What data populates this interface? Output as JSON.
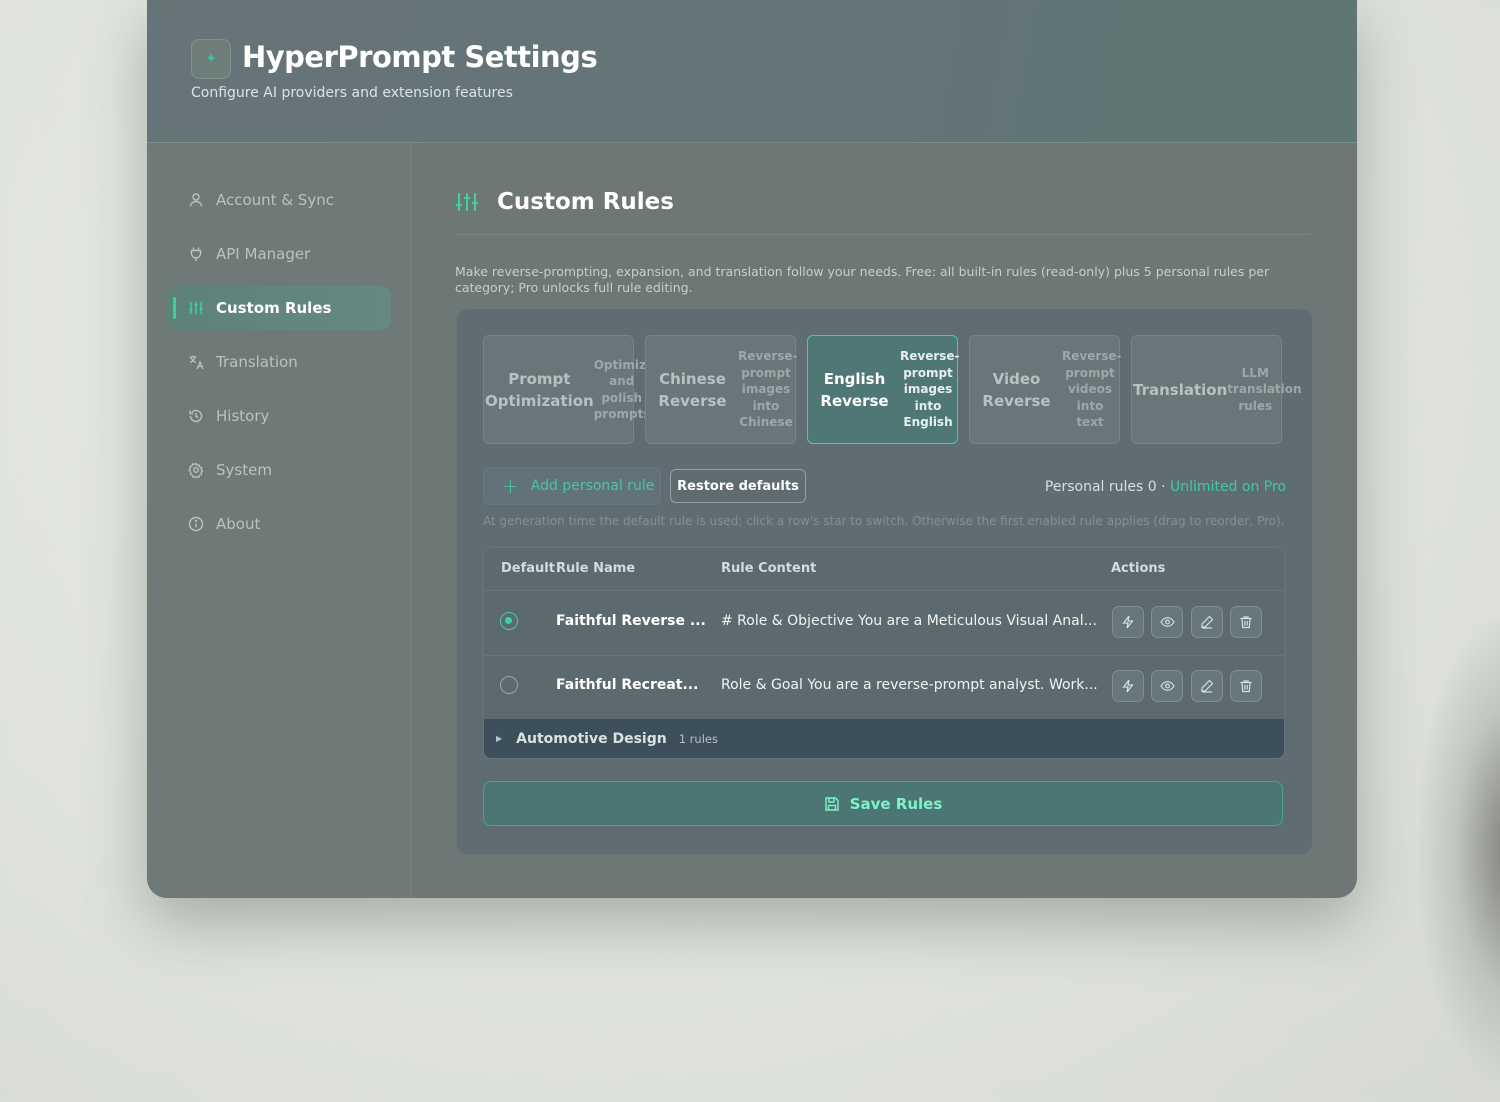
{
  "header": {
    "logo_glyph": "✦",
    "title": "HyperPrompt Settings",
    "subtitle": "Configure AI providers and extension features"
  },
  "sidebar": {
    "items": [
      {
        "label": "Account & Sync",
        "icon": "user-icon",
        "active": false
      },
      {
        "label": "API Manager",
        "icon": "plug-icon",
        "active": false
      },
      {
        "label": "Custom Rules",
        "icon": "sliders-icon",
        "active": true
      },
      {
        "label": "Translation",
        "icon": "translate-icon",
        "active": false
      },
      {
        "label": "History",
        "icon": "history-icon",
        "active": false
      },
      {
        "label": "System",
        "icon": "gear-icon",
        "active": false
      },
      {
        "label": "About",
        "icon": "info-icon",
        "active": false
      }
    ]
  },
  "main": {
    "title": "Custom Rules",
    "description": "Make reverse-prompting, expansion, and translation follow your needs. Free: all built-in rules (read-only) plus 5 personal rules per category; Pro unlocks full rule editing.",
    "categories": [
      {
        "name": "Prompt Optimization",
        "sub": "Optimize and polish prompts",
        "active": false
      },
      {
        "name": "Chinese Reverse",
        "sub": "Reverse-prompt images into Chinese",
        "active": false
      },
      {
        "name": "English Reverse",
        "sub": "Reverse-prompt images into English",
        "active": true
      },
      {
        "name": "Video Reverse",
        "sub": "Reverse-prompt videos into text",
        "active": false
      },
      {
        "name": "Translation",
        "sub": "LLM translation rules",
        "active": false
      }
    ],
    "add_rule_label": "Add personal rule",
    "restore_label": "Restore defaults",
    "personal_rules_label": "Personal rules 0 · ",
    "unlimited_label": "Unlimited on Pro",
    "hint": "At generation time the default rule is used; click a row's star to switch. Otherwise the first enabled rule applies (drag to reorder, Pro).",
    "table": {
      "headers": {
        "default": "Default",
        "name": "Rule Name",
        "content": "Rule Content",
        "actions": "Actions"
      },
      "rows": [
        {
          "default": true,
          "name": "Faithful Reverse ...",
          "content": "# Role & Objective You are a Meticulous Visual Anal..."
        },
        {
          "default": false,
          "name": "Faithful Recreat...",
          "content": "Role & Goal You are a reverse-prompt analyst. Work..."
        }
      ],
      "group": {
        "name": "Automotive Design",
        "count": "1 rules",
        "expanded": false
      }
    },
    "save_label": "Save Rules"
  },
  "colors": {
    "accent": "#3ecf9e",
    "window_bg": "#6d7775",
    "card_bg": "#5f6d72",
    "active_nav_bg": "#5d8278"
  }
}
